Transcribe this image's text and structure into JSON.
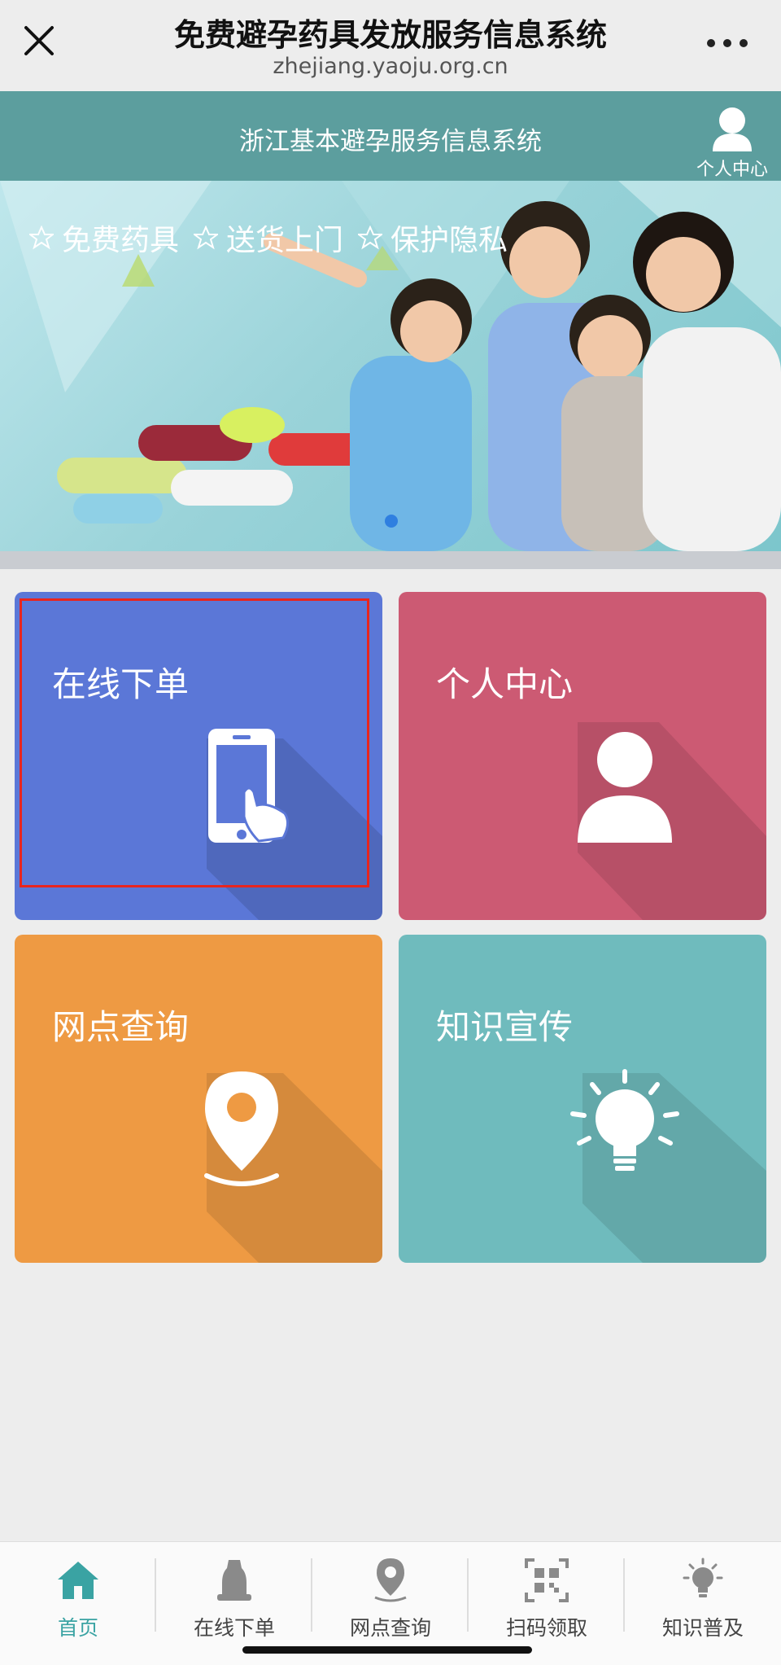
{
  "browser": {
    "title": "免费避孕药具发放服务信息系统",
    "url": "zhejiang.yaoju.org.cn"
  },
  "header": {
    "title": "浙江基本避孕服务信息系统",
    "user_label": "个人中心"
  },
  "banner": {
    "tags": [
      "免费药具",
      "送货上门",
      "保护隐私"
    ]
  },
  "tiles": [
    {
      "label": "在线下单",
      "icon": "phone-touch-icon",
      "color": "#5b77d7"
    },
    {
      "label": "个人中心",
      "icon": "user-icon",
      "color": "#cc5a73"
    },
    {
      "label": "网点查询",
      "icon": "location-pin-icon",
      "color": "#ee9a43"
    },
    {
      "label": "知识宣传",
      "icon": "lightbulb-icon",
      "color": "#6fbbbd"
    }
  ],
  "nav": [
    {
      "label": "首页",
      "icon": "home-icon",
      "active": true
    },
    {
      "label": "在线下单",
      "icon": "bottle-icon",
      "active": false
    },
    {
      "label": "网点查询",
      "icon": "location-pin-icon",
      "active": false
    },
    {
      "label": "扫码领取",
      "icon": "qr-scan-icon",
      "active": false
    },
    {
      "label": "知识普及",
      "icon": "lightbulb-icon",
      "active": false
    }
  ],
  "colors": {
    "accent": "#3aa3a3",
    "header": "#5c9e9e",
    "highlight": "#e8251e"
  }
}
